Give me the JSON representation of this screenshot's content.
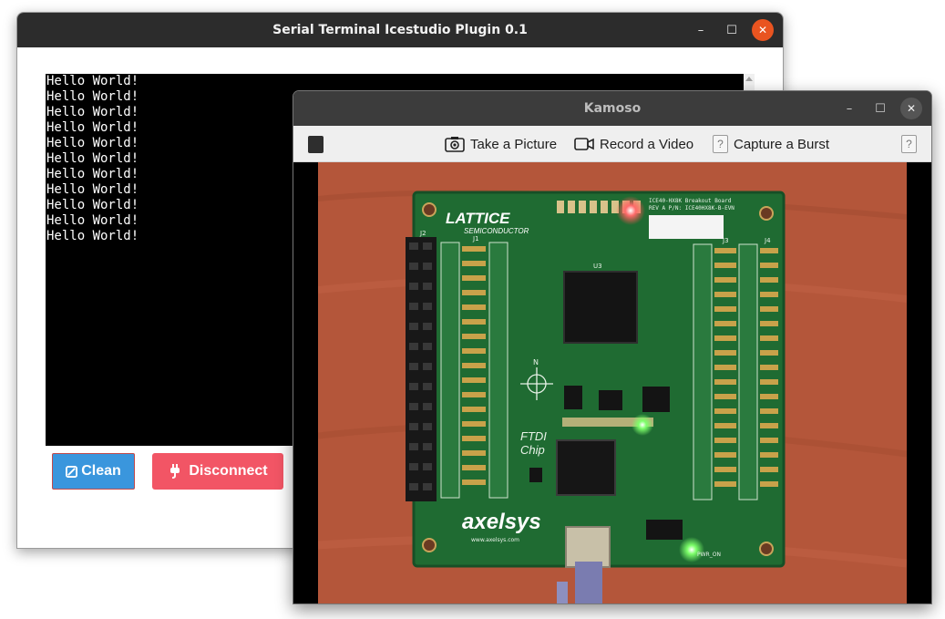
{
  "terminal_window": {
    "title": "Serial Terminal Icestudio Plugin 0.1",
    "controls": {
      "minimize": "–",
      "maximize": "☐",
      "close": "✕"
    },
    "output_lines": [
      "Hello World!",
      "Hello World!",
      "Hello World!",
      "Hello World!",
      "Hello World!",
      "Hello World!",
      "Hello World!",
      "Hello World!",
      "Hello World!",
      "Hello World!",
      "Hello World!"
    ],
    "clean_button": {
      "icon": "eraser-icon",
      "label": "Clean"
    },
    "disconnect_button": {
      "icon": "plug-icon",
      "label": "Disconnect"
    }
  },
  "kamoso_window": {
    "title": "Kamoso",
    "controls": {
      "minimize": "–",
      "maximize": "☐",
      "close": "✕"
    },
    "toolbar": {
      "take_picture": "Take a Picture",
      "record_video": "Record a Video",
      "capture_burst": "Capture a Burst",
      "help_glyph": "?"
    },
    "board_labels": {
      "lattice": "LATTICE",
      "semiconductor": "SEMICONDUCTOR",
      "board_name": "ICE40-HX8K Breakout Board",
      "board_rev": "REV A P/N: ICE40HX8K-B-EVN",
      "ftdi": "FTDI",
      "chip": "Chip",
      "axelsys": "axelsys",
      "url": "www.axelsys.com",
      "pwr": "PWR_ON",
      "u3": "U3",
      "j2": "J2",
      "j3": "J3",
      "j4": "J4",
      "j1": "J1",
      "north": "N"
    },
    "colors": {
      "table": "#b4563a",
      "pcb": "#1f6b32",
      "led_red": "#ff4a4a",
      "led_green": "#7dff6a"
    }
  }
}
